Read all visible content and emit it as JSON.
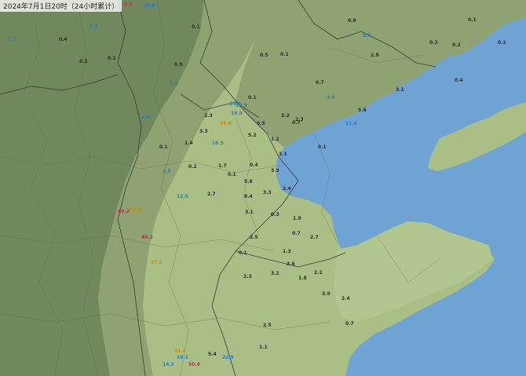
{
  "map": {
    "title": "2024年7月1日20时（24小时累计）",
    "colors": {
      "sea": "#6fa3d4",
      "plain": "#a9bf86",
      "hills": "#8ea371",
      "mountains": "#71885c",
      "boundary": "#3a3a3a"
    }
  },
  "stations": [
    {
      "name": "",
      "value": "29.0",
      "level": "light"
    },
    {
      "name": "",
      "value": "2.3",
      "level": "heavy"
    },
    {
      "name": "",
      "value": "0.1",
      "level": "zero"
    },
    {
      "name": "",
      "value": "1.8",
      "level": "light"
    },
    {
      "name": "",
      "value": "0.4",
      "level": "zero"
    },
    {
      "name": "",
      "value": "0.2",
      "level": "zero"
    },
    {
      "name": "",
      "value": "0.1",
      "level": "zero"
    },
    {
      "name": "",
      "value": "0.9",
      "level": "zero"
    },
    {
      "name": "",
      "value": "3.8",
      "level": "light"
    },
    {
      "name": "",
      "value": "2.3",
      "level": "light"
    },
    {
      "name": "",
      "value": "1.7",
      "level": "light"
    },
    {
      "name": "",
      "value": "0.5",
      "level": "zero"
    },
    {
      "name": "",
      "value": "0.1",
      "level": "zero"
    },
    {
      "name": "",
      "value": "0.3",
      "level": "zero"
    },
    {
      "name": "",
      "value": "0.2",
      "level": "zero"
    },
    {
      "name": "",
      "value": "0.1",
      "level": "zero"
    },
    {
      "name": "",
      "value": "0.2",
      "level": "zero"
    },
    {
      "name": "",
      "value": "3.1",
      "level": "zero"
    },
    {
      "name": "",
      "value": "0.4",
      "level": "zero"
    },
    {
      "name": "",
      "value": "5.0",
      "level": "light"
    },
    {
      "name": "",
      "value": "0.9",
      "level": "zero"
    },
    {
      "name": "",
      "value": "2.8",
      "level": "zero"
    },
    {
      "name": "",
      "value": "0.7",
      "level": "zero"
    },
    {
      "name": "",
      "value": "3.9",
      "level": "light"
    },
    {
      "name": "",
      "value": "0.1",
      "level": "zero"
    },
    {
      "name": "",
      "value": "5.6",
      "level": "zero"
    },
    {
      "name": "",
      "value": "3.2",
      "level": "zero"
    },
    {
      "name": "",
      "value": "0.7",
      "level": "zero"
    },
    {
      "name": "",
      "value": "0.5",
      "level": "zero"
    },
    {
      "name": "",
      "value": "11.6",
      "level": "light"
    },
    {
      "name": "",
      "value": "2.3",
      "level": "zero"
    },
    {
      "name": "",
      "value": "20.9",
      "level": "light"
    },
    {
      "name": "",
      "value": "19.5",
      "level": "light"
    },
    {
      "name": "",
      "value": "14.6",
      "level": "light"
    },
    {
      "name": "",
      "value": "5.2",
      "level": "zero"
    },
    {
      "name": "",
      "value": "1.2",
      "level": "zero"
    },
    {
      "name": "",
      "value": "0.1",
      "level": "zero"
    },
    {
      "name": "",
      "value": "2.1",
      "level": "zero"
    },
    {
      "name": "",
      "value": "3.9",
      "level": "zero"
    },
    {
      "name": "",
      "value": "2.3",
      "level": "zero"
    },
    {
      "name": "",
      "value": "33.4",
      "level": "moderate"
    },
    {
      "name": "",
      "value": "16.5",
      "level": "light"
    },
    {
      "name": "",
      "value": "3.3",
      "level": "zero"
    },
    {
      "name": "",
      "value": "1.4",
      "level": "zero"
    },
    {
      "name": "",
      "value": "0.1",
      "level": "zero"
    },
    {
      "name": "",
      "value": "1.5",
      "level": "light"
    },
    {
      "name": "",
      "value": "0.2",
      "level": "zero"
    },
    {
      "name": "",
      "value": "1.7",
      "level": "zero"
    },
    {
      "name": "",
      "value": "12.5",
      "level": "light"
    },
    {
      "name": "",
      "value": "2.7",
      "level": "zero"
    },
    {
      "name": "",
      "value": "0.4",
      "level": "zero"
    },
    {
      "name": "",
      "value": "5.6",
      "level": "zero"
    },
    {
      "name": "",
      "value": "0.1",
      "level": "zero"
    },
    {
      "name": "",
      "value": "8.4",
      "level": "zero"
    },
    {
      "name": "",
      "value": "3.3",
      "level": "zero"
    },
    {
      "name": "",
      "value": "2.4",
      "level": "zero"
    },
    {
      "name": "",
      "value": "0.3",
      "level": "zero"
    },
    {
      "name": "",
      "value": "3.1",
      "level": "zero"
    },
    {
      "name": "",
      "value": "2.5",
      "level": "zero"
    },
    {
      "name": "",
      "value": "0.1",
      "level": "zero"
    },
    {
      "name": "",
      "value": "0.7",
      "level": "zero"
    },
    {
      "name": "",
      "value": "2.7",
      "level": "zero"
    },
    {
      "name": "",
      "value": "1.9",
      "level": "zero"
    },
    {
      "name": "",
      "value": "1.3",
      "level": "zero"
    },
    {
      "name": "",
      "value": "3.6",
      "level": "zero"
    },
    {
      "name": "",
      "value": "3.2",
      "level": "zero"
    },
    {
      "name": "",
      "value": "2.3",
      "level": "zero"
    },
    {
      "name": "",
      "value": "1.8",
      "level": "zero"
    },
    {
      "name": "",
      "value": "2.2",
      "level": "zero"
    },
    {
      "name": "",
      "value": "3.9",
      "level": "zero"
    },
    {
      "name": "",
      "value": "2.4",
      "level": "zero"
    },
    {
      "name": "",
      "value": "0.7",
      "level": "zero"
    },
    {
      "name": "",
      "value": "2.5",
      "level": "zero"
    },
    {
      "name": "",
      "value": "1.1",
      "level": "zero"
    },
    {
      "name": "",
      "value": "5.4",
      "level": "zero"
    },
    {
      "name": "",
      "value": "22.9",
      "level": "light"
    },
    {
      "name": "",
      "value": "18.1",
      "level": "light"
    },
    {
      "name": "",
      "value": "14.3",
      "level": "light"
    },
    {
      "name": "",
      "value": "31.4",
      "level": "moderate"
    },
    {
      "name": "",
      "value": "50.4",
      "level": "heavy"
    },
    {
      "name": "",
      "value": "60.2",
      "level": "heavy"
    },
    {
      "name": "",
      "value": "37.0",
      "level": "moderate"
    },
    {
      "name": "",
      "value": "48.2",
      "level": "heavy"
    },
    {
      "name": "",
      "value": "27.5",
      "level": "moderate"
    }
  ]
}
